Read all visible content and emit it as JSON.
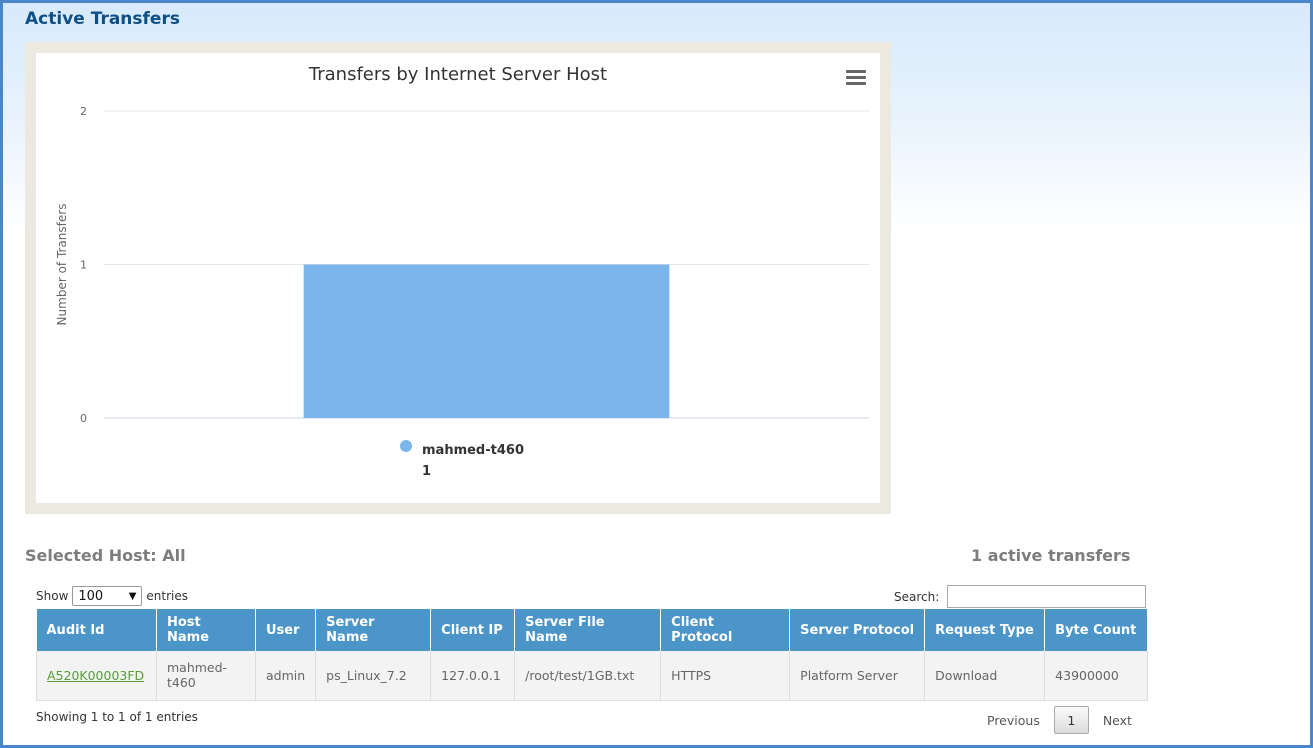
{
  "page": {
    "title": "Active Transfers"
  },
  "chart_data": {
    "type": "bar",
    "title": "Transfers by Internet Server Host",
    "ylabel": "Number of Transfers",
    "xlabel": "",
    "categories": [
      "mahmed-t460"
    ],
    "values": [
      1
    ],
    "ylim": [
      0,
      2
    ],
    "yticks": [
      "0",
      "1",
      "2"
    ],
    "color": "#7cb4ec",
    "grid": true,
    "legend": {
      "placement": "bottom",
      "items": [
        {
          "name": "mahmed-t460",
          "value": "1"
        }
      ]
    }
  },
  "selected_host": "Selected Host: All",
  "active_count": "1 active transfers",
  "controls": {
    "show_label": "Show",
    "entries_value": "100",
    "entries_label": "entries",
    "search_label": "Search:",
    "search_value": ""
  },
  "table": {
    "columns": [
      "Audit Id",
      "Host Name",
      "User",
      "Server Name",
      "Client IP",
      "Server File Name",
      "Client Protocol",
      "Server Protocol",
      "Request Type",
      "Byte Count"
    ],
    "rows": [
      [
        "A520K00003FD",
        "mahmed-t460",
        "admin",
        "ps_Linux_7.2",
        "127.0.0.1",
        "/root/test/1GB.txt",
        "HTTPS",
        "Platform Server",
        "Download",
        "43900000"
      ]
    ]
  },
  "footer": {
    "showing": "Showing 1 to 1 of 1 entries",
    "previous": "Previous",
    "page": "1",
    "next": "Next"
  },
  "icons": {
    "chart_menu": "hamburger-menu-icon",
    "select_arrow": "triangle-down-icon"
  }
}
